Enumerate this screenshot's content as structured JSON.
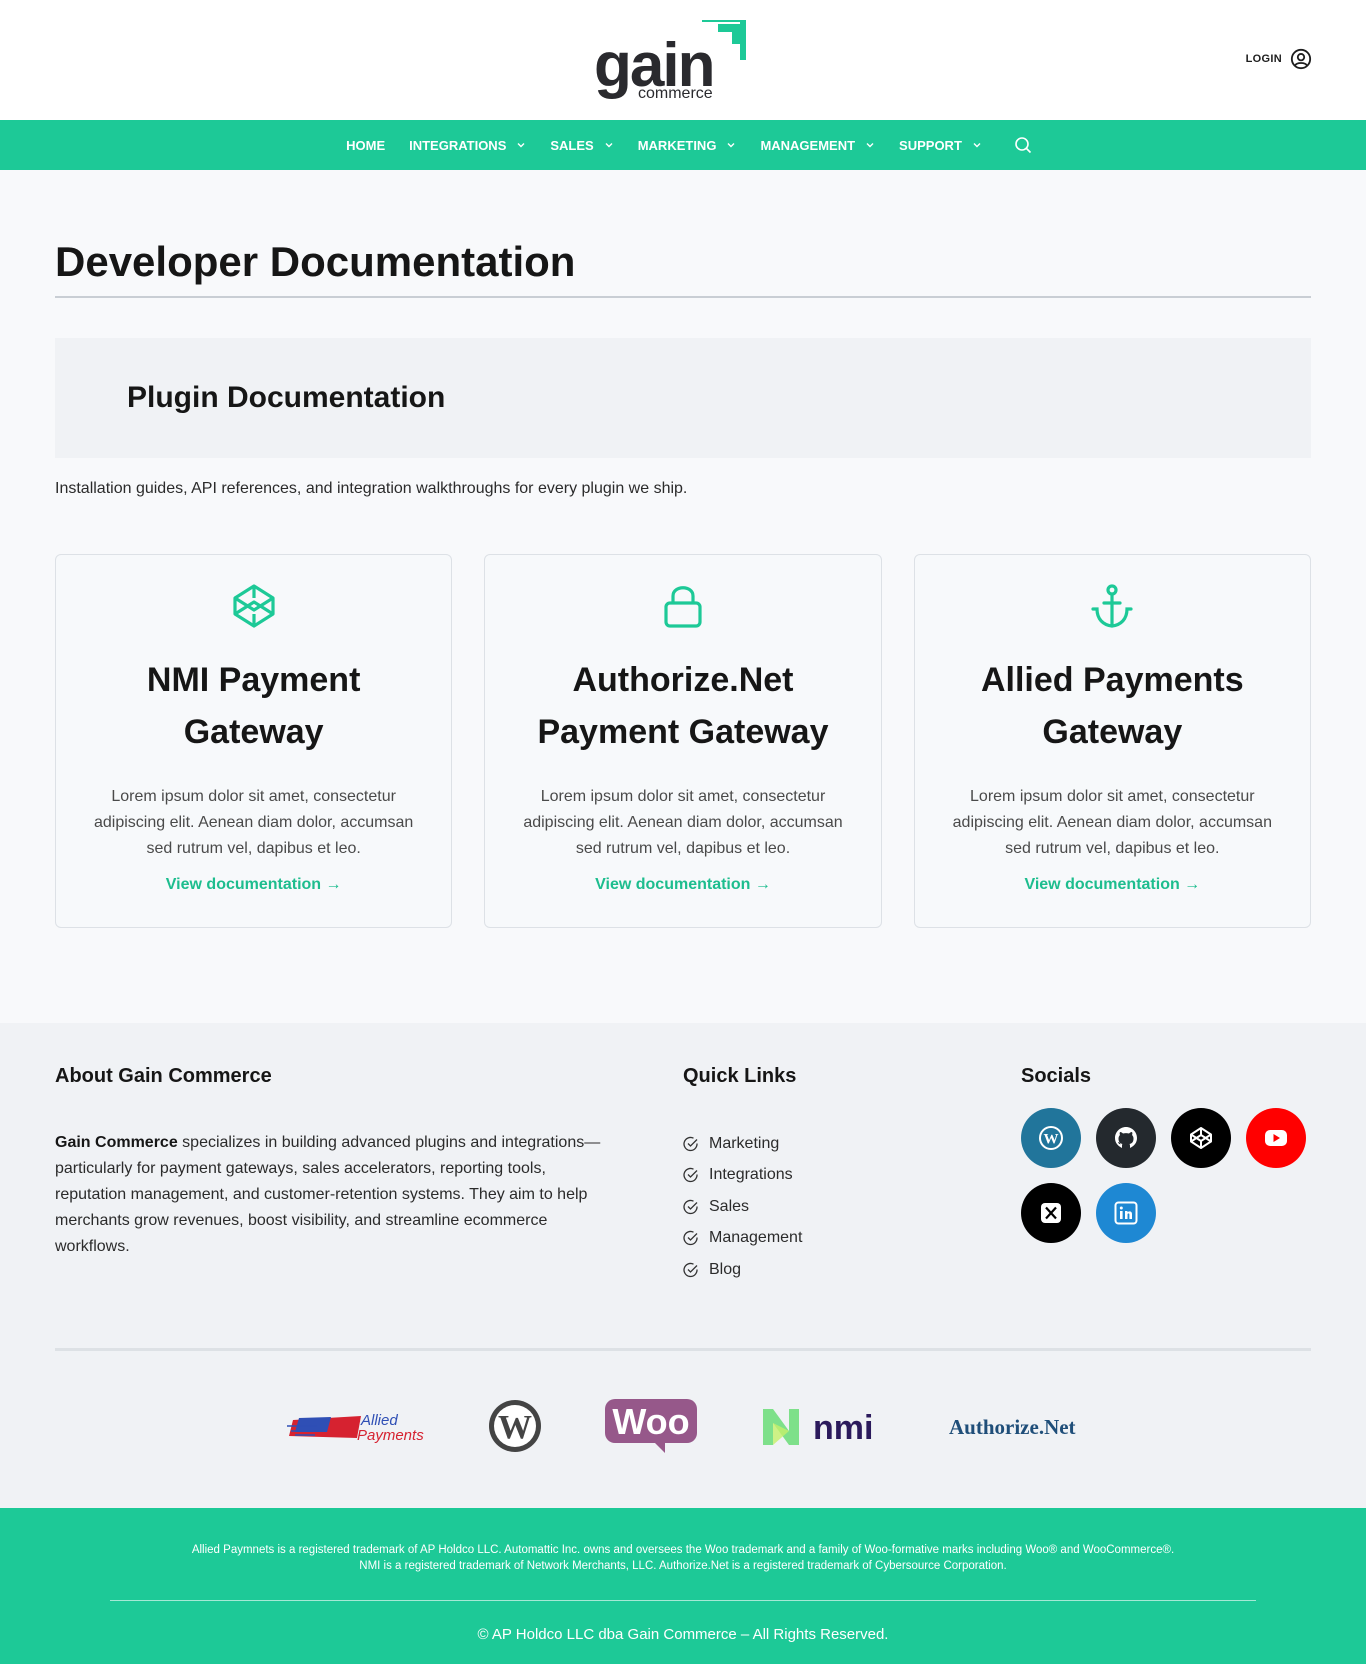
{
  "header": {
    "logo_text": "gain",
    "logo_sub": "commerce",
    "login_label": "LOGIN"
  },
  "nav": {
    "items": [
      {
        "label": "HOME",
        "dropdown": false
      },
      {
        "label": "INTEGRATIONS",
        "dropdown": true
      },
      {
        "label": "SALES",
        "dropdown": true
      },
      {
        "label": "MARKETING",
        "dropdown": true
      },
      {
        "label": "MANAGEMENT",
        "dropdown": true
      },
      {
        "label": "SUPPORT",
        "dropdown": true
      }
    ],
    "search_icon": "search-icon"
  },
  "page": {
    "title": "Developer Documentation",
    "section_title": "Plugin Documentation",
    "intro": "Installation guides, API references, and integration walkthroughs for every plugin we ship."
  },
  "cards": [
    {
      "icon": "codepen-icon",
      "title": "NMI Payment Gateway",
      "text": "Lorem ipsum dolor sit amet, consectetur adipiscing elit. Aenean diam dolor, accumsan sed rutrum vel, dapibus et leo.",
      "link": "View documentation →"
    },
    {
      "icon": "lock-icon",
      "title": "Authorize.Net Payment Gateway",
      "text": "Lorem ipsum dolor sit amet, consectetur adipiscing elit. Aenean diam dolor, accumsan sed rutrum vel, dapibus et leo.",
      "link": "View documentation →"
    },
    {
      "icon": "anchor-icon",
      "title": "Allied Payments Gateway",
      "text": "Lorem ipsum dolor sit amet, consectetur adipiscing elit. Aenean diam dolor, accumsan sed rutrum vel, dapibus et leo.",
      "link": "View documentation →"
    }
  ],
  "footer": {
    "about_title": "About Gain Commerce",
    "about_bold": "Gain Commerce",
    "about_text": " specializes in building advanced plugins and integrations—particularly for payment gateways, sales accelerators, reporting tools, reputation management, and customer-retention systems. They aim to help merchants grow revenues, boost visibility, and streamline ecommerce workflows.",
    "links_title": "Quick Links",
    "links": [
      "Marketing",
      "Integrations",
      "Sales",
      "Management",
      "Blog"
    ],
    "socials_title": "Socials",
    "socials": [
      {
        "name": "wordpress-icon",
        "color": "#21759b"
      },
      {
        "name": "github-icon",
        "color": "#24292e"
      },
      {
        "name": "codepen-icon",
        "color": "#000000"
      },
      {
        "name": "youtube-icon",
        "color": "#ff0000"
      },
      {
        "name": "x-icon",
        "color": "#000000"
      },
      {
        "name": "linkedin-icon",
        "color": "#1e88d3"
      }
    ],
    "partner_logos": {
      "allied_line1": "Allied",
      "allied_line2": "Payments",
      "woo": "Woo",
      "nmi": "nmi",
      "authorize": "Authorize.Net"
    },
    "legal_line1": "Allied Paymnets is a registered trademark of AP Holdco LLC. Automattic Inc. owns and oversees the Woo trademark and a family of Woo-formative marks including Woo® and WooCommerce®.",
    "legal_line2": "NMI is a registered trademark of Network Merchants, LLC. Authorize.Net is a registered trademark of Cybersource Corporation.",
    "copyright": "© AP Holdco LLC dba Gain Commerce – All Rights Reserved."
  },
  "colors": {
    "accent": "#1dc997",
    "link": "#1dbd8e"
  }
}
